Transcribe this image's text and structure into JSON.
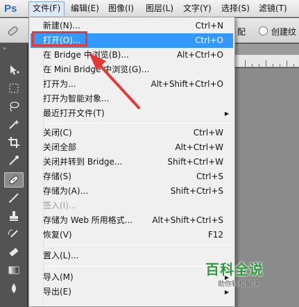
{
  "app": {
    "logo": "Ps"
  },
  "menubar": {
    "items": [
      {
        "label": "文件(F)",
        "active": true
      },
      {
        "label": "编辑(E)"
      },
      {
        "label": "图像(I)"
      },
      {
        "label": "图层(L)"
      },
      {
        "label": "文字(Y)"
      },
      {
        "label": "选择(S)"
      },
      {
        "label": "滤镜(T)"
      }
    ]
  },
  "options": {
    "text_partial": "配",
    "radio_label": "创建纹"
  },
  "file_menu": {
    "items": [
      {
        "label": "新建(N)...",
        "shortcut": "Ctrl+N"
      },
      {
        "label": "打开(O)...",
        "shortcut": "Ctrl+O",
        "highlighted": true
      },
      {
        "label": "在 Bridge 中浏览(B)...",
        "shortcut": "Alt+Ctrl+O"
      },
      {
        "label": "在 Mini Bridge 中浏览(G)...",
        "shortcut": ""
      },
      {
        "label": "打开为...",
        "shortcut": "Alt+Shift+Ctrl+O"
      },
      {
        "label": "打开为智能对象...",
        "shortcut": ""
      },
      {
        "label": "最近打开文件(T)",
        "shortcut": "",
        "submenu": true
      },
      {
        "label": "关闭(C)",
        "shortcut": "Ctrl+W"
      },
      {
        "label": "关闭全部",
        "shortcut": "Alt+Ctrl+W"
      },
      {
        "label": "关闭并转到 Bridge...",
        "shortcut": "Shift+Ctrl+W"
      },
      {
        "label": "存储(S)",
        "shortcut": "Ctrl+S"
      },
      {
        "label": "存储为(A)...",
        "shortcut": "Shift+Ctrl+S"
      },
      {
        "label": "签入(I)...",
        "shortcut": "",
        "disabled": true
      },
      {
        "label": "存储为 Web 所用格式...",
        "shortcut": "Alt+Shift+Ctrl+S"
      },
      {
        "label": "恢复(V)",
        "shortcut": "F12"
      },
      {
        "label": "置入(L)...",
        "shortcut": ""
      },
      {
        "label": "导入(M)",
        "shortcut": "",
        "submenu": true
      },
      {
        "label": "导出(E)",
        "shortcut": "",
        "submenu": true
      }
    ]
  },
  "watermark": {
    "title": "百科全说",
    "subtitle": "助你轻松解决"
  },
  "colors": {
    "highlight": "#3399ff",
    "annotation": "#e53935",
    "watermark": "#2e9a3c"
  }
}
